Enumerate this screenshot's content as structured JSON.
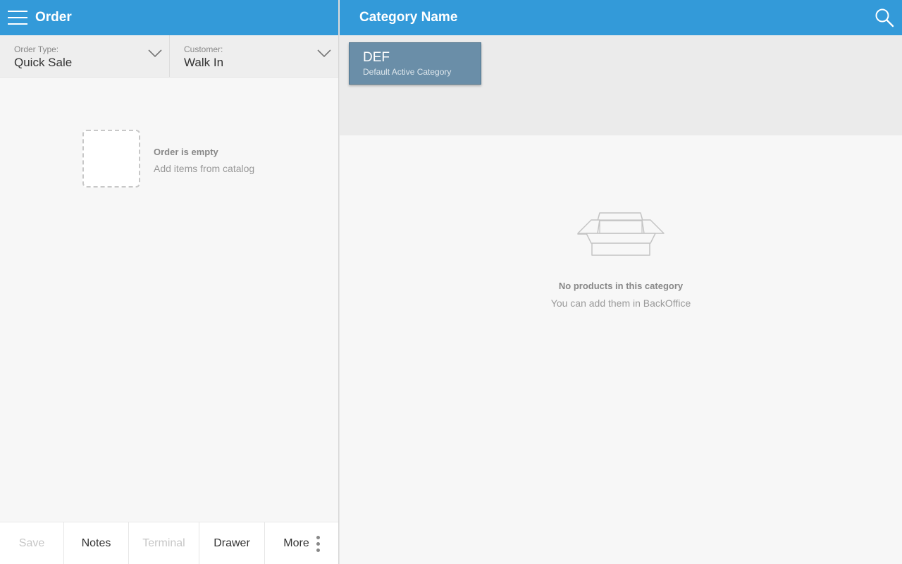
{
  "order_panel": {
    "title": "Order",
    "order_type": {
      "label": "Order Type:",
      "value": "Quick Sale"
    },
    "customer": {
      "label": "Customer:",
      "value": "Walk In"
    },
    "empty_state": {
      "title": "Order is empty",
      "subtitle": "Add items from catalog"
    },
    "actions": [
      {
        "label": "Save",
        "enabled": false
      },
      {
        "label": "Notes",
        "enabled": true
      },
      {
        "label": "Terminal",
        "enabled": false
      },
      {
        "label": "Drawer",
        "enabled": true
      },
      {
        "label": "More",
        "enabled": true
      }
    ]
  },
  "catalog_panel": {
    "title": "Category Name",
    "categories": [
      {
        "code": "DEF",
        "name": "Default Active Category",
        "selected": true
      }
    ],
    "empty_state": {
      "title": "No products in this category",
      "subtitle": "You can add them in BackOffice"
    }
  },
  "icons": {
    "menu": "hamburger-menu-icon",
    "search": "search-icon",
    "dropdown": "chevron-down-icon",
    "more": "vertical-dots-icon",
    "empty_box": "open-box-icon"
  },
  "colors": {
    "header": "#339ad9",
    "category_tile": "#6a8ea8",
    "background": "#f7f7f7"
  }
}
